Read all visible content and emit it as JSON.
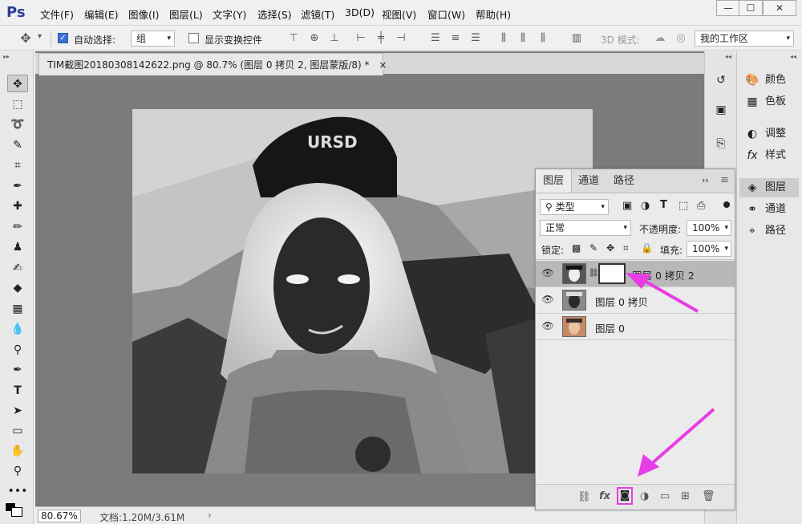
{
  "app": {
    "logo": "Ps"
  },
  "menu": [
    "文件(F)",
    "编辑(E)",
    "图像(I)",
    "图层(L)",
    "文字(Y)",
    "选择(S)",
    "滤镜(T)",
    "3D(D)",
    "视图(V)",
    "窗口(W)",
    "帮助(H)"
  ],
  "window_controls": {
    "minimize": "—",
    "maximize": "☐",
    "close": "✕"
  },
  "options": {
    "auto_select_label": "自动选择:",
    "auto_select_value": "组",
    "show_transform_label": "显示变换控件",
    "mode_label": "3D 模式:",
    "workspace": "我的工作区"
  },
  "document": {
    "tab_title": "TIM截图20180308142622.png @ 80.7% (图层 0 拷贝 2, 图层蒙版/8) *",
    "tab_close": "×"
  },
  "status": {
    "zoom": "80.67%",
    "doc_info": "文档:1.20M/3.61M",
    "arrow": "›"
  },
  "canvas": {
    "cap_text": "URSD"
  },
  "right_panel": {
    "items": [
      {
        "name": "color",
        "label": "颜色",
        "icon": "palette-icon"
      },
      {
        "name": "swatches",
        "label": "色板",
        "icon": "grid-icon"
      },
      {
        "name": "adjustments",
        "label": "调整",
        "icon": "adjust-icon"
      },
      {
        "name": "styles",
        "label": "样式",
        "icon": "fx-icon"
      },
      {
        "name": "layers",
        "label": "图层",
        "icon": "layers-icon",
        "selected": true
      },
      {
        "name": "channels",
        "label": "通道",
        "icon": "channels-icon"
      },
      {
        "name": "paths",
        "label": "路径",
        "icon": "paths-icon"
      }
    ]
  },
  "layers_panel": {
    "tabs": [
      "图层",
      "通道",
      "路径"
    ],
    "filter_label": "类型",
    "blend_mode": "正常",
    "opacity_label": "不透明度:",
    "opacity": "100%",
    "lock_label": "锁定:",
    "fill_label": "填充:",
    "fill": "100%",
    "layers": [
      {
        "name": "图层 0 拷贝 2",
        "selected": true,
        "has_mask": true
      },
      {
        "name": "图层 0 拷贝",
        "selected": false,
        "has_mask": false
      },
      {
        "name": "图层 0",
        "selected": false,
        "has_mask": false
      }
    ]
  },
  "colors": {
    "accent": "#e83ce6",
    "ps_blue": "#2a3e9c"
  }
}
